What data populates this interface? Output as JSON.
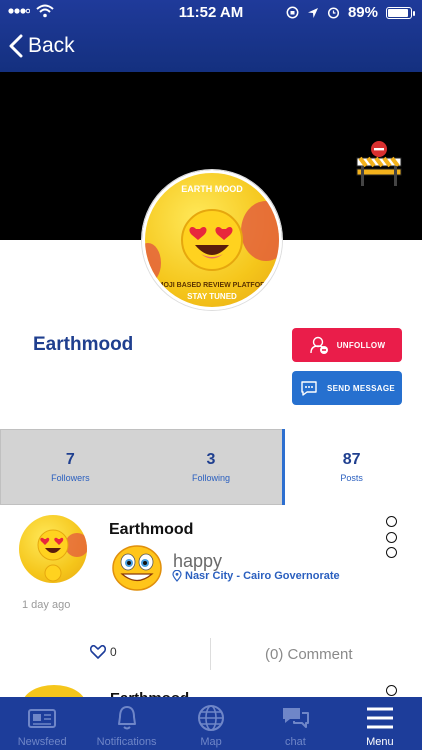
{
  "status_bar": {
    "time": "11:52 AM",
    "battery": "89%"
  },
  "nav": {
    "back_label": "Back"
  },
  "profile": {
    "name": "Earthmood",
    "avatar_logo": "EARTH MOOD",
    "avatar_caption": "EMOJI BASED REVIEW PLATFORM",
    "avatar_tagline": "STAY TUNED",
    "unfollow_label": "UNFOLLOW",
    "message_label": "SEND MESSAGE"
  },
  "stats": [
    {
      "value": "7",
      "label": "Followers"
    },
    {
      "value": "3",
      "label": "Following"
    },
    {
      "value": "87",
      "label": "Posts"
    }
  ],
  "post": {
    "author": "Earthmood",
    "mood": "happy",
    "location": "Nasr City - Cairo Governorate",
    "time": "1 day ago",
    "likes": "0",
    "comment_label": "(0) Comment"
  },
  "next_post": {
    "author": "Earthmood"
  },
  "tabs": [
    {
      "label": "Newsfeed",
      "icon": "newspaper-icon"
    },
    {
      "label": "Notifications",
      "icon": "bell-icon"
    },
    {
      "label": "Map",
      "icon": "globe-icon"
    },
    {
      "label": "chat",
      "icon": "chat-icon"
    },
    {
      "label": "Menu",
      "icon": "menu-icon"
    }
  ],
  "colors": {
    "primary": "#1d3d9a",
    "unfollow": "#ea1d4a",
    "message": "#2670cf"
  }
}
